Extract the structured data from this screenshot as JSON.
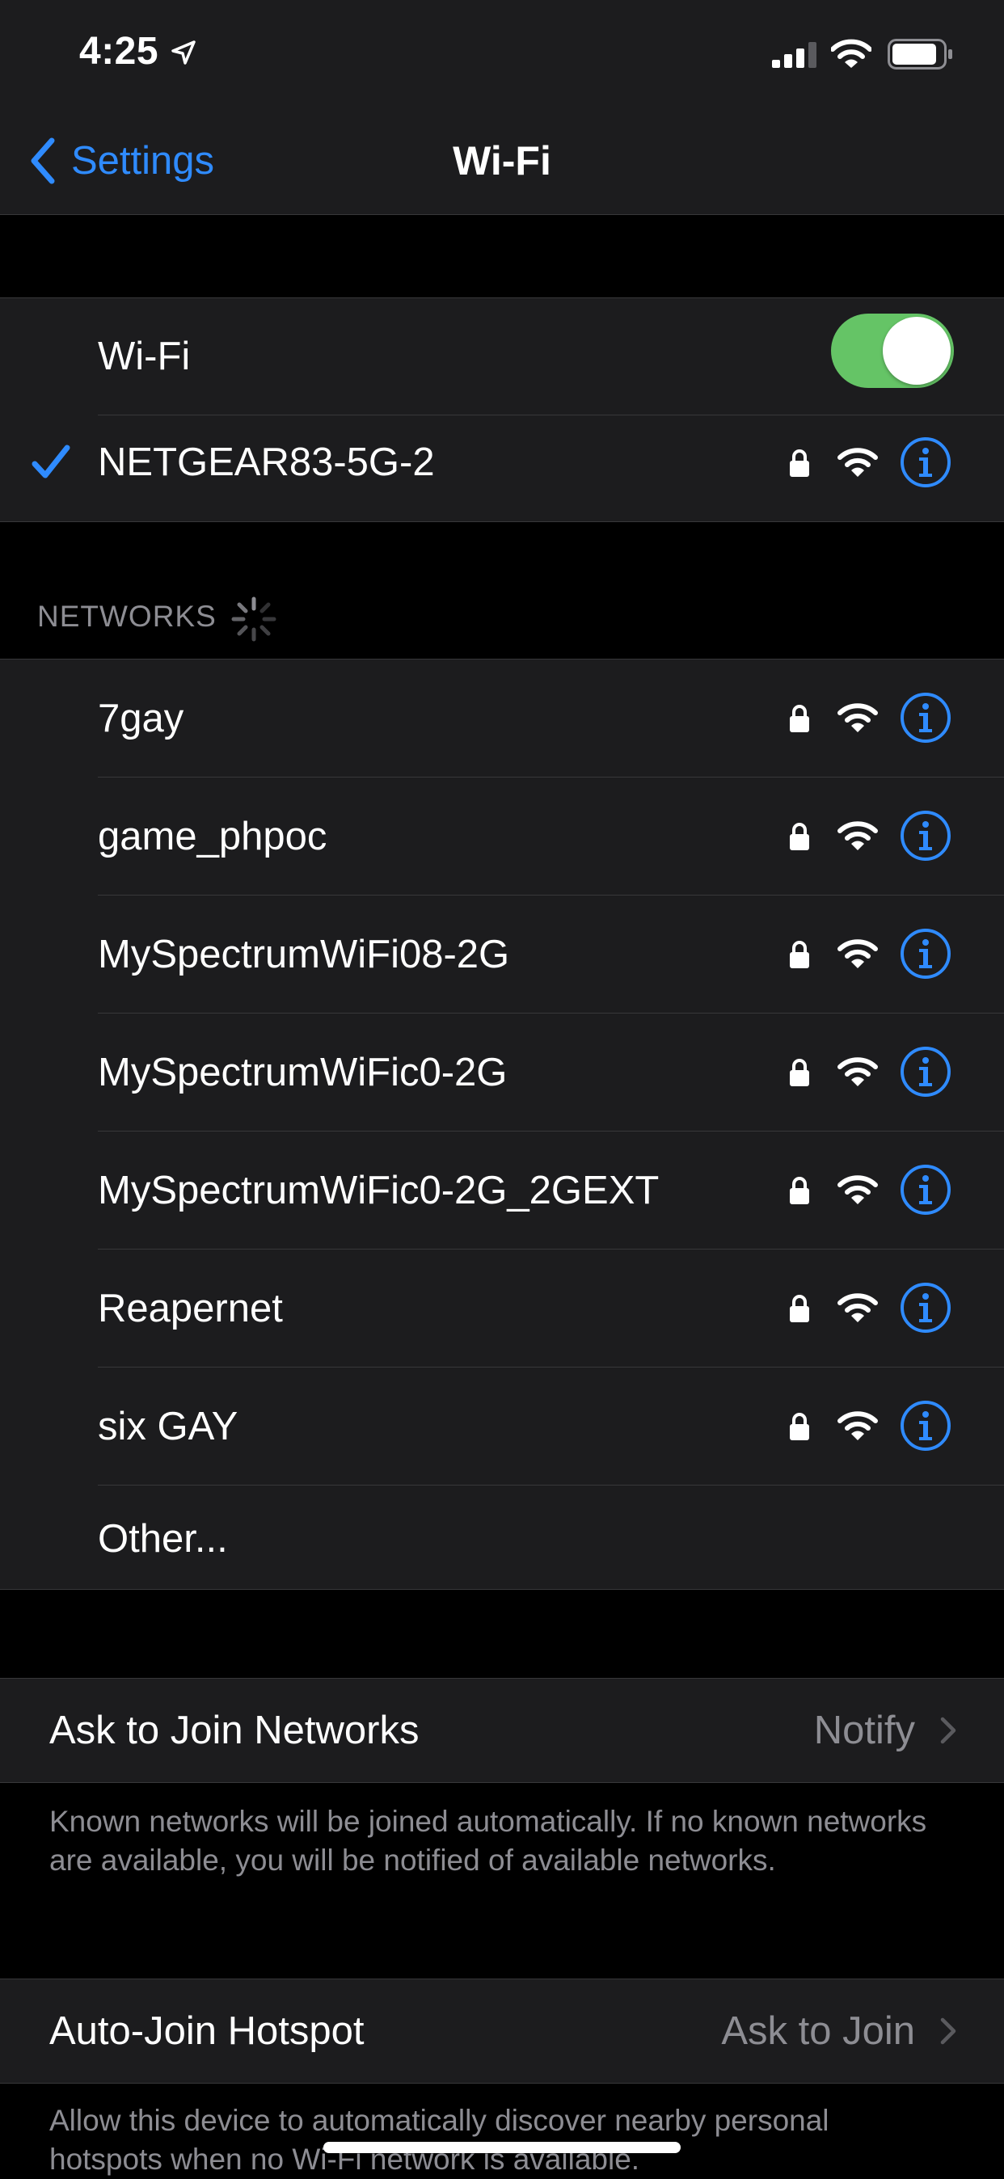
{
  "status_bar": {
    "time": "4:25"
  },
  "nav": {
    "back_label": "Settings",
    "title": "Wi-Fi"
  },
  "wifi_toggle": {
    "label": "Wi-Fi",
    "on": true
  },
  "connected": {
    "ssid": "NETGEAR83-5G-2",
    "secured": true
  },
  "networks_header": "NETWORKS",
  "networks": [
    {
      "ssid": "7gay",
      "secured": true
    },
    {
      "ssid": "game_phpoc",
      "secured": true
    },
    {
      "ssid": "MySpectrumWiFi08-2G",
      "secured": true
    },
    {
      "ssid": "MySpectrumWiFic0-2G",
      "secured": true
    },
    {
      "ssid": "MySpectrumWiFic0-2G_2GEXT",
      "secured": true
    },
    {
      "ssid": "Reapernet",
      "secured": true
    },
    {
      "ssid": "six GAY",
      "secured": true
    }
  ],
  "other_label": "Other...",
  "ask_to_join": {
    "label": "Ask to Join Networks",
    "value": "Notify",
    "footnote": "Known networks will be joined automatically. If no known networks are available, you will be notified of available networks."
  },
  "auto_join_hotspot": {
    "label": "Auto-Join Hotspot",
    "value": "Ask to Join",
    "footnote": "Allow this device to automatically discover nearby personal hotspots when no Wi-Fi network is available."
  },
  "colors": {
    "accent": "#2f8bff",
    "toggle_on": "#65c466",
    "cell_bg": "#1c1c1e",
    "secondary_text": "#8d8d93"
  }
}
